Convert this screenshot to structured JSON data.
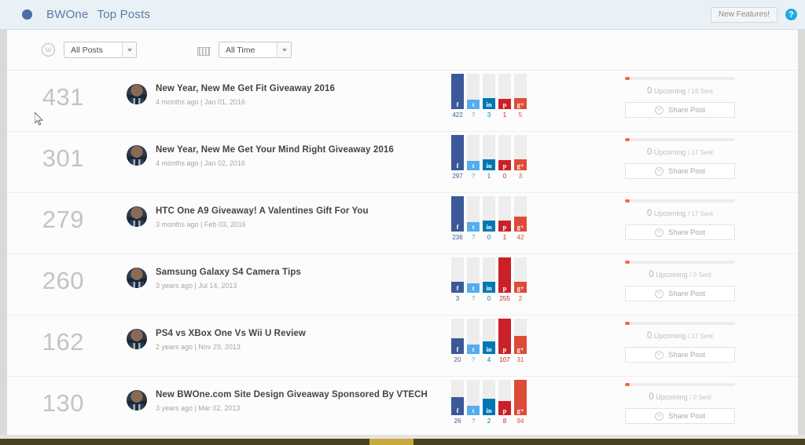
{
  "topbar": {
    "brand": "BWOne",
    "page_title": "Top Posts",
    "new_features_label": "New Features!",
    "help_label": "?",
    "brand_color": "#5b7aa8",
    "help_color": "#22a8e0"
  },
  "filters": {
    "posts": {
      "icon": "wordpress-icon",
      "value": "All Posts"
    },
    "time": {
      "icon": "calendar-icon",
      "value": "All Time"
    }
  },
  "networks": [
    {
      "key": "facebook",
      "glyph": "f",
      "color": "#3b5998",
      "badge_bg": "#3b5998",
      "count_color": "#3b5998"
    },
    {
      "key": "twitter",
      "glyph": "t",
      "color": "#55acee",
      "badge_bg": "#55acee",
      "count_color": "#55acee"
    },
    {
      "key": "linkedin",
      "glyph": "in",
      "color": "#0077b5",
      "badge_bg": "#0077b5",
      "count_color": "#0077b5"
    },
    {
      "key": "pinterest",
      "glyph": "p",
      "color": "#cb2027",
      "badge_bg": "#cb2027",
      "count_color": "#cb2027"
    },
    {
      "key": "googleplus",
      "glyph": "g+",
      "color": "#dd4b39",
      "badge_bg": "#dd4b39",
      "count_color": "#dd4b39"
    }
  ],
  "share_button_label": "Share Post",
  "upcoming_word": "Upcoming",
  "rows": [
    {
      "rank": "431",
      "title": "New Year, New Me Get Fit Giveaway 2016",
      "meta": "4 months ago | Jan 01, 2016",
      "shares": {
        "facebook": "422",
        "twitter": "?",
        "linkedin": "3",
        "pinterest": "1",
        "googleplus": "5"
      },
      "fills": {
        "facebook": 33,
        "twitter": 0,
        "linkedin": 2,
        "pinterest": 1,
        "googleplus": 2
      },
      "upcoming": "0",
      "sent": "/ 19 Sent"
    },
    {
      "rank": "301",
      "title": "New Year, New Me Get Your Mind Right Giveaway 2016",
      "meta": "4 months ago | Jan 02, 2016",
      "shares": {
        "facebook": "297",
        "twitter": "?",
        "linkedin": "1",
        "pinterest": "0",
        "googleplus": "3"
      },
      "fills": {
        "facebook": 33,
        "twitter": 0,
        "linkedin": 2,
        "pinterest": 1,
        "googleplus": 2
      },
      "upcoming": "0",
      "sent": "/ 17 Sent"
    },
    {
      "rank": "279",
      "title": "HTC One A9 Giveaway! A Valentines Gift For You",
      "meta": "3 months ago | Feb 03, 2016",
      "shares": {
        "facebook": "236",
        "twitter": "?",
        "linkedin": "0",
        "pinterest": "1",
        "googleplus": "42"
      },
      "fills": {
        "facebook": 33,
        "twitter": 0,
        "linkedin": 2,
        "pinterest": 2,
        "googleplus": 7
      },
      "upcoming": "0",
      "sent": "/ 17 Sent"
    },
    {
      "rank": "260",
      "title": "Samsung Galaxy S4 Camera Tips",
      "meta": "3 years ago | Jul 14, 2013",
      "shares": {
        "facebook": "3",
        "twitter": "?",
        "linkedin": "0",
        "pinterest": "255",
        "googleplus": "2"
      },
      "fills": {
        "facebook": 2,
        "twitter": 0,
        "linkedin": 2,
        "pinterest": 33,
        "googleplus": 2
      },
      "upcoming": "0",
      "sent": "/ 0 Sent"
    },
    {
      "rank": "162",
      "title": "PS4 vs XBox One Vs Wii U Review",
      "meta": "2 years ago | Nov 29, 2013",
      "shares": {
        "facebook": "20",
        "twitter": "?",
        "linkedin": "4",
        "pinterest": "107",
        "googleplus": "31"
      },
      "fills": {
        "facebook": 8,
        "twitter": 0,
        "linkedin": 4,
        "pinterest": 33,
        "googleplus": 11
      },
      "upcoming": "0",
      "sent": "/ 17 Sent"
    },
    {
      "rank": "130",
      "title": "New BWOne.com Site Design Giveaway Sponsored By VTECH",
      "meta": "3 years ago | Mar 02, 2013",
      "shares": {
        "facebook": "26",
        "twitter": "?",
        "linkedin": "2",
        "pinterest": "8",
        "googleplus": "94"
      },
      "fills": {
        "facebook": 11,
        "twitter": 0,
        "linkedin": 9,
        "pinterest": 6,
        "googleplus": 33
      },
      "upcoming": "0",
      "sent": "/ 0 Sent"
    }
  ]
}
